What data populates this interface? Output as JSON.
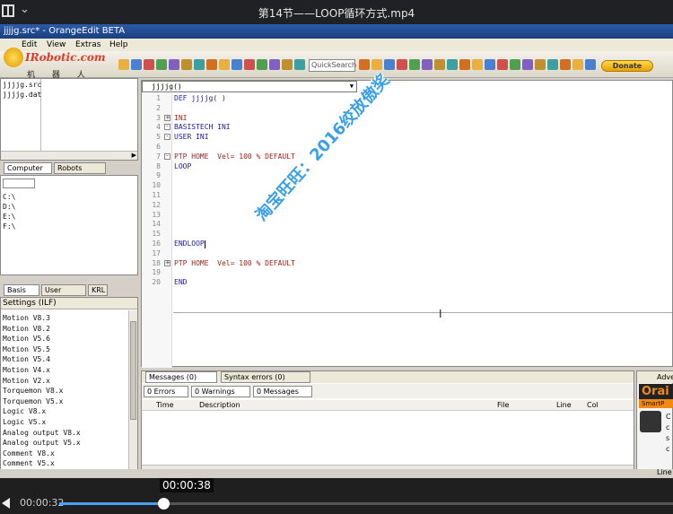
{
  "player": {
    "title": "第14节——LOOP循环方式.mp4",
    "current_time": "00:00:32",
    "hover_time": "00:00:38",
    "progress": 0.17
  },
  "window": {
    "title": "jjjjg.src* - OrangeEdit BETA"
  },
  "menu": [
    "Edit",
    "View",
    "Extras",
    "Help"
  ],
  "toolbar": {
    "quicksearch_placeholder": "QuickSearch",
    "donate_label": "Donate"
  },
  "logo": {
    "text": "IRobotic.com",
    "chinese": "机 器 人 在 线"
  },
  "files": [
    "jjjjg.src",
    "jjjjg.dat"
  ],
  "left_tabs": [
    "Computer",
    "Robots"
  ],
  "drives": [
    "C:\\",
    "D:\\",
    "E:\\",
    "F:\\"
  ],
  "settings_tabs": [
    "Basis",
    "User",
    "KRL"
  ],
  "settings": {
    "title": "Settings (ILF)",
    "items": [
      "Motion V8.3",
      "Motion V8.2",
      "Motion V5.6",
      "Motion V5.5",
      "Motion V5.4",
      "Motion V4.x",
      "Motion V2.x",
      "Torquemon V8.x",
      "Torquemon V5.x",
      "Logic V8.x",
      "Logic V5.x",
      "Analog output V8.x",
      "Analog output V5.x",
      "Comment V8.x",
      "Comment V5.x"
    ]
  },
  "editor": {
    "tab_label": "jjjjg()",
    "lines": [
      {
        "n": "1",
        "text": "DEF jjjjg( )",
        "cls": "kw"
      },
      {
        "n": "2",
        "text": "",
        "cls": ""
      },
      {
        "n": "3",
        "text": "INI",
        "cls": "kw2"
      },
      {
        "n": "4",
        "text": "BASISTECH INI",
        "cls": "kw"
      },
      {
        "n": "5",
        "text": "USER INI",
        "cls": "kw"
      },
      {
        "n": "6",
        "text": "",
        "cls": ""
      },
      {
        "n": "7",
        "text": "PTP HOME  Vel= 100 % DEFAULT",
        "cls": "kw2"
      },
      {
        "n": "8",
        "text": "LOOP",
        "cls": "kw"
      },
      {
        "n": "9",
        "text": "",
        "cls": ""
      },
      {
        "n": "10",
        "text": "",
        "cls": ""
      },
      {
        "n": "11",
        "text": "",
        "cls": ""
      },
      {
        "n": "12",
        "text": "",
        "cls": ""
      },
      {
        "n": "13",
        "text": "",
        "cls": ""
      },
      {
        "n": "14",
        "text": "",
        "cls": ""
      },
      {
        "n": "15",
        "text": "",
        "cls": ""
      },
      {
        "n": "16",
        "text": "ENDLOOP",
        "cls": "kw"
      },
      {
        "n": "17",
        "text": "",
        "cls": ""
      },
      {
        "n": "18",
        "text": "PTP HOME  Vel= 100 % DEFAULT",
        "cls": "kw2"
      },
      {
        "n": "19",
        "text": "",
        "cls": ""
      },
      {
        "n": "20",
        "text": "END",
        "cls": "kw"
      }
    ]
  },
  "watermark": "淘宝旺旺：2016绞放傲奖",
  "messages": {
    "tabs": [
      "Messages (0)",
      "Syntax errors (0)"
    ],
    "filters": [
      "0 Errors",
      "0 Warnings",
      "0 Messages"
    ],
    "columns": [
      "Time",
      "Description",
      "File",
      "Line",
      "Col"
    ]
  },
  "promo": {
    "tab": "Adve",
    "brand": "Orai",
    "sub": "SmartP",
    "letters": [
      "C",
      "c",
      "s",
      "c"
    ]
  },
  "status": "Line"
}
